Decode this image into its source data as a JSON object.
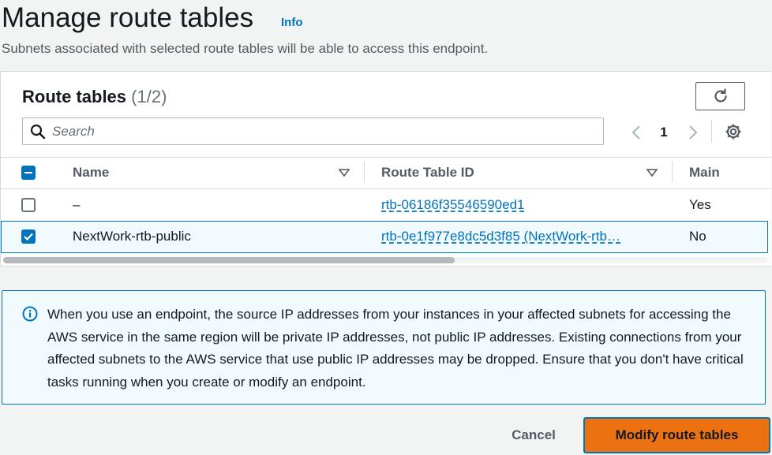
{
  "header": {
    "title": "Manage route tables",
    "info_label": "Info",
    "description": "Subnets associated with selected route tables will be able to access this endpoint."
  },
  "panel": {
    "title": "Route tables",
    "count": "(1/2)"
  },
  "search": {
    "placeholder": "Search",
    "value": ""
  },
  "pagination": {
    "current_page": "1"
  },
  "table": {
    "columns": [
      "Name",
      "Route Table ID",
      "Main"
    ],
    "rows": [
      {
        "selected": false,
        "name": "–",
        "route_table_id": "rtb-06186f35546590ed1",
        "main": "Yes"
      },
      {
        "selected": true,
        "name": "NextWork-rtb-public",
        "route_table_id": "rtb-0e1f977e8dc5d3f85 (NextWork-rtb…",
        "main": "No"
      }
    ]
  },
  "alert": {
    "icon": "info-circle-icon",
    "text": "When you use an endpoint, the source IP addresses from your instances in your affected subnets for accessing the AWS service in the same region will be private IP addresses, not public IP addresses. Existing connections from your affected subnets to the AWS service that use public IP addresses may be dropped. Ensure that you don't have critical tasks running when you create or modify an endpoint."
  },
  "footer": {
    "cancel_label": "Cancel",
    "primary_label": "Modify route tables"
  },
  "colors": {
    "primary": "#ec7211",
    "link": "#0073bb",
    "info_bg": "#f1faff"
  }
}
